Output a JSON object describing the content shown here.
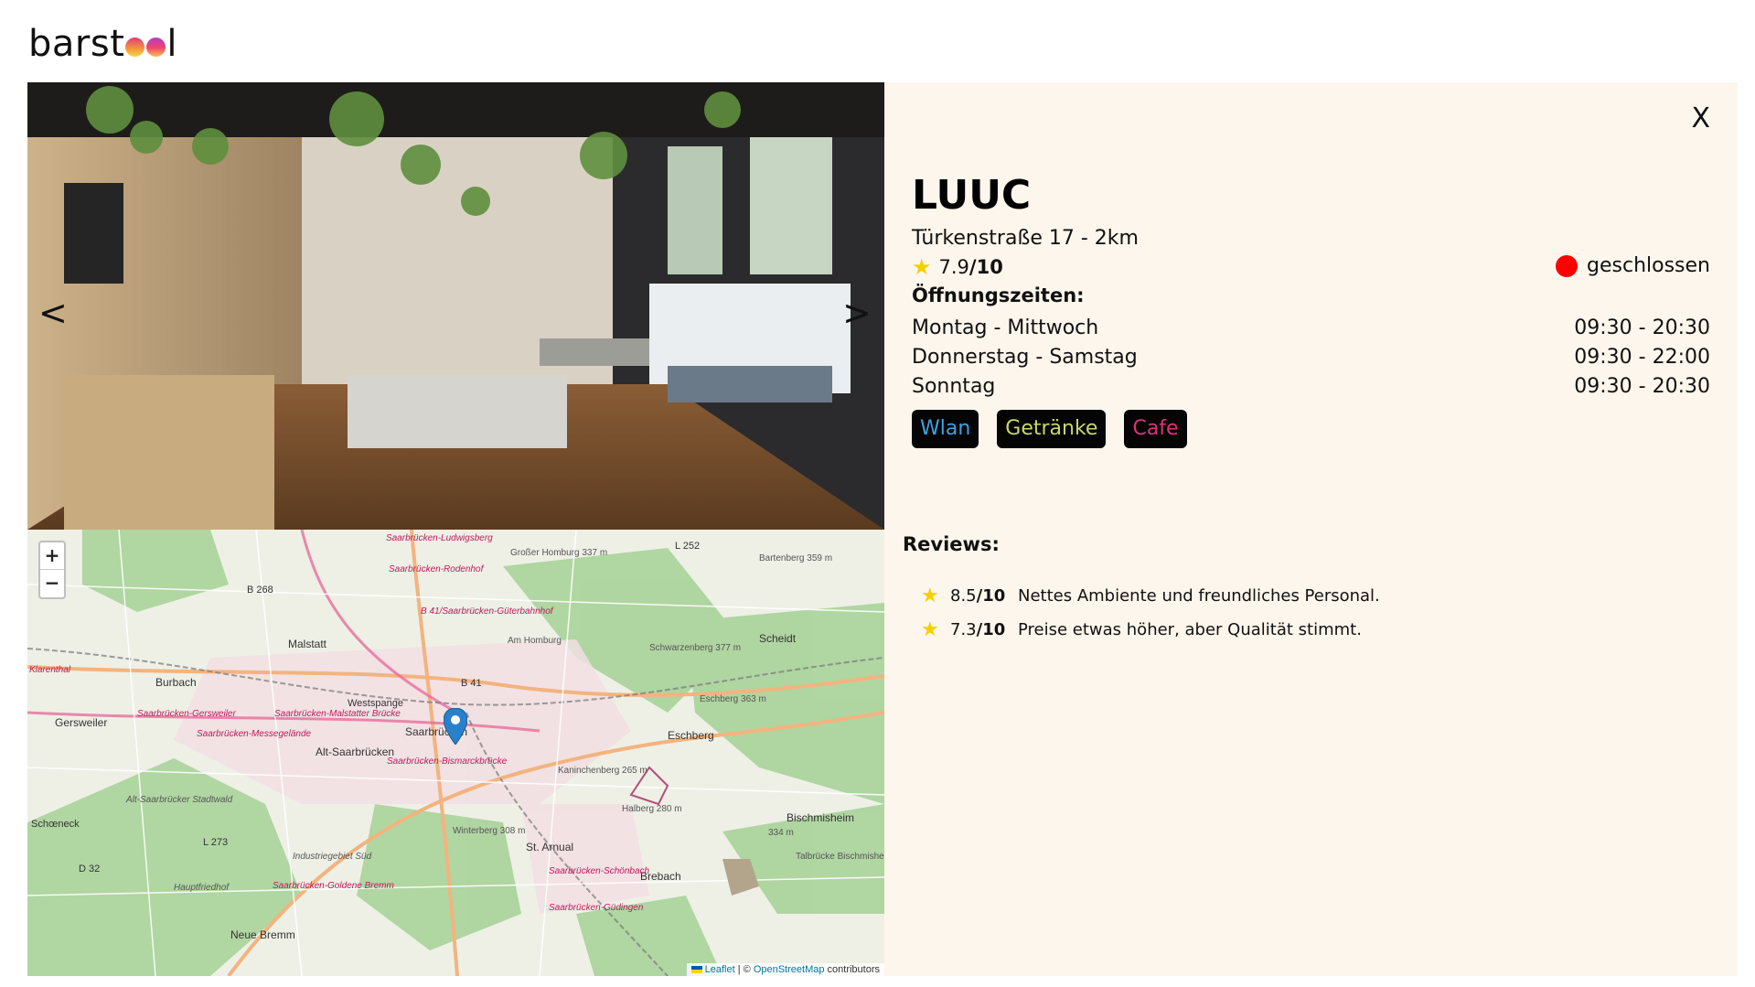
{
  "app": {
    "logo_prefix": "barst",
    "logo_suffix": "l"
  },
  "carousel": {
    "prev_label": "<",
    "next_label": ">"
  },
  "map": {
    "zoom_in": "+",
    "zoom_out": "−",
    "attribution_leaflet": "Leaflet",
    "attribution_sep": " | © ",
    "attribution_osm": "OpenStreetMap",
    "attribution_tail": " contributors",
    "labels": [
      {
        "text": "Saarbrücken-Ludwigsberg"
      },
      {
        "text": "Großer Homburg 337 m"
      },
      {
        "text": "L 252"
      },
      {
        "text": "Bartenberg 359 m"
      },
      {
        "text": "B 268"
      },
      {
        "text": "Saarbrücken-Rodenhof"
      },
      {
        "text": "B 41/Saarbrücken-Güterbahnhof"
      },
      {
        "text": "Malstatt"
      },
      {
        "text": "Am Homburg"
      },
      {
        "text": "Scheidt"
      },
      {
        "text": "Klarenthal"
      },
      {
        "text": "Burbach"
      },
      {
        "text": "Schwarzenberg 377 m"
      },
      {
        "text": "B 41"
      },
      {
        "text": "Westspange"
      },
      {
        "text": "Saarbrücken-Gersweiler"
      },
      {
        "text": "Saarbrücken-Malstatter Brücke"
      },
      {
        "text": "Gersweiler"
      },
      {
        "text": "Saarbrücken"
      },
      {
        "text": "Eschberg 363 m"
      },
      {
        "text": "Eschberg"
      },
      {
        "text": "Saarbrücken-Messegelände"
      },
      {
        "text": "Alt-Saarbrücken"
      },
      {
        "text": "Saarbrücken-Bismarckbrücke"
      },
      {
        "text": "Kaninchenberg 265 m"
      },
      {
        "text": "Alt-Saarbrücker Stadtwald"
      },
      {
        "text": "Halberg 280 m"
      },
      {
        "text": "Bischmisheim"
      },
      {
        "text": "Schœneck"
      },
      {
        "text": "Winterberg 308 m"
      },
      {
        "text": "334 m"
      },
      {
        "text": "L 273"
      },
      {
        "text": "St. Arnual"
      },
      {
        "text": "D 32"
      },
      {
        "text": "Industriegebiet Süd"
      },
      {
        "text": "Talbrücke Bischmisheim"
      },
      {
        "text": "Brebach"
      },
      {
        "text": "Saarbrücken-Goldene Bremm"
      },
      {
        "text": "Hauptfriedhof"
      },
      {
        "text": "Saarbrücken-Schönbach"
      },
      {
        "text": "Saarbrücken-Güdingen"
      },
      {
        "text": "Neue Bremm"
      }
    ]
  },
  "detail": {
    "close_label": "X",
    "name": "LUUC",
    "address": "Türkenstraße 17 - 2km",
    "rating_value": "7.9",
    "rating_max": "/10",
    "status_text": "geschlossen",
    "status_color": "#ff0000",
    "hours_title": "Öffnungszeiten:",
    "hours": [
      {
        "days": "Montag - Mittwoch",
        "time": "09:30 - 20:30"
      },
      {
        "days": "Donnerstag - Samstag",
        "time": "09:30 - 22:00"
      },
      {
        "days": "Sonntag",
        "time": "09:30 - 20:30"
      }
    ],
    "tags": [
      {
        "label": "Wlan",
        "color": "#3aa3e0"
      },
      {
        "label": "Getränke",
        "color": "#c8d86a"
      },
      {
        "label": "Cafe",
        "color": "#e0307a"
      }
    ],
    "reviews_title": "Reviews:",
    "reviews": [
      {
        "score": "8.5",
        "max": "/10",
        "text": "Nettes Ambiente und freundliches Personal."
      },
      {
        "score": "7.3",
        "max": "/10",
        "text": "Preise etwas höher, aber Qualität stimmt."
      }
    ]
  }
}
